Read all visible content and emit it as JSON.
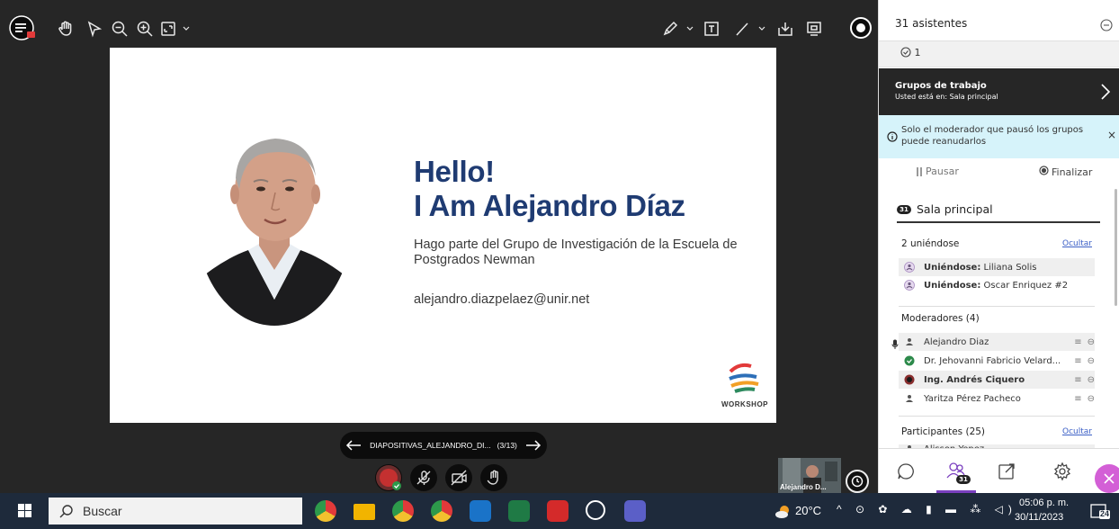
{
  "toolbar": {
    "icons": [
      "menu-icon",
      "hand-icon",
      "pointer-icon",
      "zoom-out-icon",
      "zoom-in-icon",
      "fit-screen-icon",
      "dropdown-icon",
      "pen-icon",
      "text-tool-icon",
      "line-tool-icon",
      "download-icon",
      "presenter-view-icon",
      "record-icon"
    ]
  },
  "slide": {
    "title_line1": "Hello!",
    "title_line2": "I Am Alejandro Díaz",
    "intro": "Hago parte del Grupo de Investigación de la Escuela de Postgrados Newman",
    "email": "alejandro.diazpelaez@unir.net",
    "logo_text": "WORKSHOP",
    "colors": {
      "title": "#1f3b72",
      "background": "#ffffff"
    }
  },
  "slide_nav": {
    "file_name": "DIAPOSITIVAS_ALEJANDRO_DI...",
    "position": "(3/13)"
  },
  "camera": {
    "name": "Alejandro D..."
  },
  "panel": {
    "title": "31 asistentes",
    "raised_hands": "1",
    "groups_title": "Grupos de trabajo",
    "groups_location": "Usted está en: Sala principal",
    "notice": "Solo el moderador que pausó los grupos puede reanudarlos",
    "pause_label": "Pausar",
    "end_label": "Finalizar",
    "room_count": "31",
    "room_name": "Sala principal",
    "joining": {
      "header": "2 uniéndose",
      "hide_link": "Ocultar",
      "items": [
        {
          "prefix": "Uniéndose:",
          "name": "Liliana Solis"
        },
        {
          "prefix": "Uniéndose:",
          "name": "Oscar Enriquez #2"
        }
      ]
    },
    "moderators": {
      "header": "Moderadores (4)",
      "items": [
        {
          "name": "Alejandro Diaz"
        },
        {
          "name": "Dr. Jehovanni Fabricio Velard..."
        },
        {
          "name": "Ing. Andrés Ciquero"
        },
        {
          "name": "Yaritza Pérez Pacheco"
        }
      ]
    },
    "participants": {
      "header": "Participantes (25)",
      "hide_link": "Ocultar",
      "items": [
        {
          "name": "Alisson Yepez"
        }
      ]
    },
    "nav_badge": "31",
    "accent": "#7a3fbf"
  },
  "taskbar": {
    "search_placeholder": "Buscar",
    "weather": "20°C",
    "time": "05:06 p. m.",
    "date": "30/11/2023",
    "notifications": "24"
  }
}
